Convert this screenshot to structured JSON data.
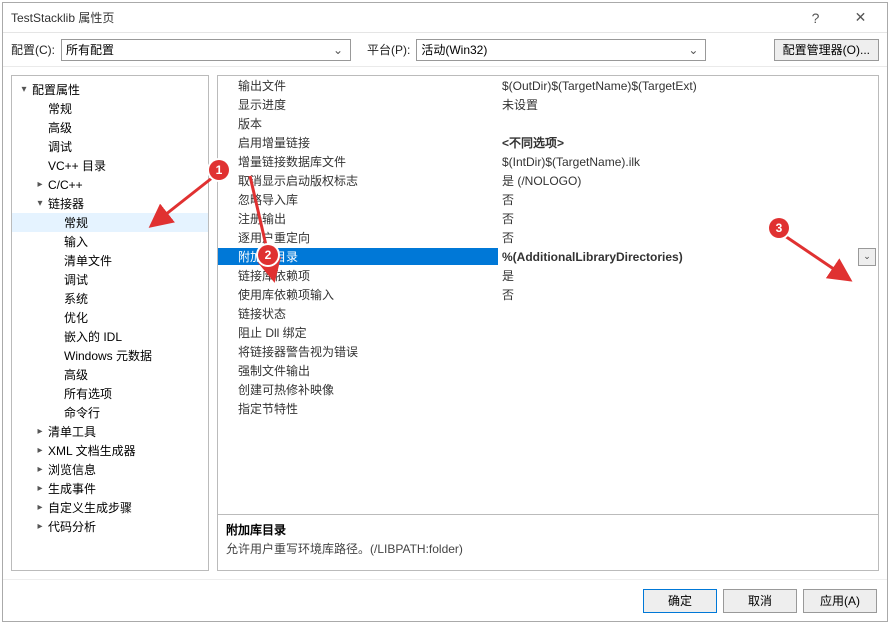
{
  "titlebar": {
    "title": "TestStacklib 属性页",
    "help": "?",
    "close": "✕"
  },
  "toolbar": {
    "config_label": "配置(C):",
    "config_value": "所有配置",
    "platform_label": "平台(P):",
    "platform_value": "活动(Win32)",
    "cfg_manager": "配置管理器(O)..."
  },
  "tree": [
    {
      "label": "配置属性",
      "depth": 0,
      "exp": "▾"
    },
    {
      "label": "常规",
      "depth": 1,
      "exp": ""
    },
    {
      "label": "高级",
      "depth": 1,
      "exp": ""
    },
    {
      "label": "调试",
      "depth": 1,
      "exp": ""
    },
    {
      "label": "VC++ 目录",
      "depth": 1,
      "exp": ""
    },
    {
      "label": "C/C++",
      "depth": 1,
      "exp": "▸"
    },
    {
      "label": "链接器",
      "depth": 1,
      "exp": "▾"
    },
    {
      "label": "常规",
      "depth": 2,
      "exp": "",
      "sel": true
    },
    {
      "label": "输入",
      "depth": 2,
      "exp": ""
    },
    {
      "label": "清单文件",
      "depth": 2,
      "exp": ""
    },
    {
      "label": "调试",
      "depth": 2,
      "exp": ""
    },
    {
      "label": "系统",
      "depth": 2,
      "exp": ""
    },
    {
      "label": "优化",
      "depth": 2,
      "exp": ""
    },
    {
      "label": "嵌入的 IDL",
      "depth": 2,
      "exp": ""
    },
    {
      "label": "Windows 元数据",
      "depth": 2,
      "exp": ""
    },
    {
      "label": "高级",
      "depth": 2,
      "exp": ""
    },
    {
      "label": "所有选项",
      "depth": 2,
      "exp": ""
    },
    {
      "label": "命令行",
      "depth": 2,
      "exp": ""
    },
    {
      "label": "清单工具",
      "depth": 1,
      "exp": "▸"
    },
    {
      "label": "XML 文档生成器",
      "depth": 1,
      "exp": "▸"
    },
    {
      "label": "浏览信息",
      "depth": 1,
      "exp": "▸"
    },
    {
      "label": "生成事件",
      "depth": 1,
      "exp": "▸"
    },
    {
      "label": "自定义生成步骤",
      "depth": 1,
      "exp": "▸"
    },
    {
      "label": "代码分析",
      "depth": 1,
      "exp": "▸"
    }
  ],
  "props": [
    {
      "name": "输出文件",
      "value": "$(OutDir)$(TargetName)$(TargetExt)"
    },
    {
      "name": "显示进度",
      "value": "未设置"
    },
    {
      "name": "版本",
      "value": ""
    },
    {
      "name": "启用增量链接",
      "value": "<不同选项>",
      "bold": true
    },
    {
      "name": "增量链接数据库文件",
      "value": "$(IntDir)$(TargetName).ilk"
    },
    {
      "name": "取消显示启动版权标志",
      "value": "是 (/NOLOGO)"
    },
    {
      "name": "忽略导入库",
      "value": "否"
    },
    {
      "name": "注册输出",
      "value": "否"
    },
    {
      "name": "逐用户重定向",
      "value": "否"
    },
    {
      "name": "附加库目录",
      "value": "%(AdditionalLibraryDirectories)",
      "sel": true
    },
    {
      "name": "链接库依赖项",
      "value": "是"
    },
    {
      "name": "使用库依赖项输入",
      "value": "否"
    },
    {
      "name": "链接状态",
      "value": ""
    },
    {
      "name": "阻止 Dll 绑定",
      "value": ""
    },
    {
      "name": "将链接器警告视为错误",
      "value": ""
    },
    {
      "name": "强制文件输出",
      "value": ""
    },
    {
      "name": "创建可热修补映像",
      "value": ""
    },
    {
      "name": "指定节特性",
      "value": ""
    }
  ],
  "description": {
    "title": "附加库目录",
    "body": "允许用户重写环境库路径。(/LIBPATH:folder)"
  },
  "footer": {
    "ok": "确定",
    "cancel": "取消",
    "apply": "应用(A)"
  },
  "annotations": {
    "b1": "1",
    "b2": "2",
    "b3": "3"
  }
}
